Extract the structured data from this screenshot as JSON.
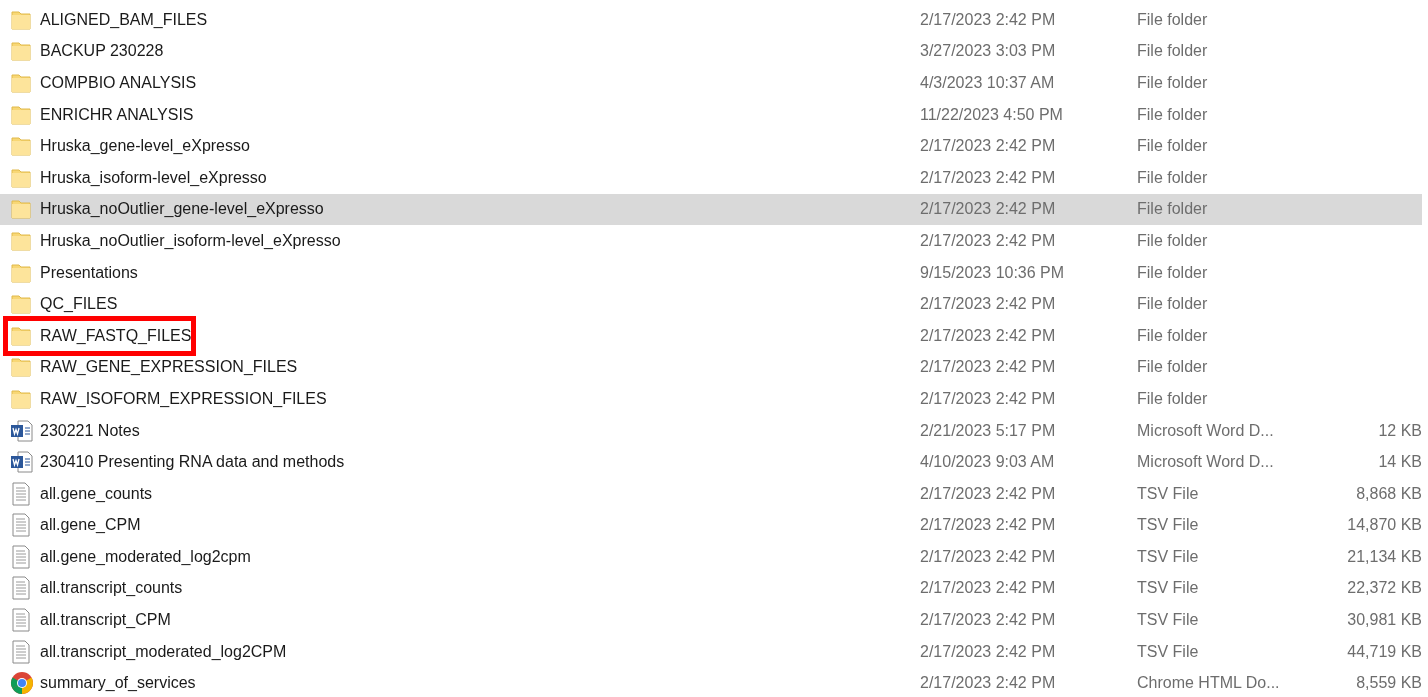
{
  "files": [
    {
      "kind": "folder",
      "name": "ALIGNED_BAM_FILES",
      "modified": "2/17/2023 2:42 PM",
      "type": "File folder",
      "selected": false,
      "highlighted": false
    },
    {
      "kind": "folder",
      "name": "BACKUP 230228",
      "modified": "3/27/2023 3:03 PM",
      "type": "File folder",
      "selected": false,
      "highlighted": false
    },
    {
      "kind": "folder",
      "name": "COMPBIO ANALYSIS",
      "modified": "4/3/2023 10:37 AM",
      "type": "File folder",
      "selected": false,
      "highlighted": false
    },
    {
      "kind": "folder",
      "name": "ENRICHR ANALYSIS",
      "modified": "11/22/2023 4:50 PM",
      "type": "File folder",
      "selected": false,
      "highlighted": false
    },
    {
      "kind": "folder",
      "name": "Hruska_gene-level_eXpresso",
      "modified": "2/17/2023 2:42 PM",
      "type": "File folder",
      "selected": false,
      "highlighted": false
    },
    {
      "kind": "folder",
      "name": "Hruska_isoform-level_eXpresso",
      "modified": "2/17/2023 2:42 PM",
      "type": "File folder",
      "selected": false,
      "highlighted": false
    },
    {
      "kind": "folder",
      "name": "Hruska_noOutlier_gene-level_eXpresso",
      "modified": "2/17/2023 2:42 PM",
      "type": "File folder",
      "selected": true,
      "highlighted": false
    },
    {
      "kind": "folder",
      "name": "Hruska_noOutlier_isoform-level_eXpresso",
      "modified": "2/17/2023 2:42 PM",
      "type": "File folder",
      "selected": false,
      "highlighted": false
    },
    {
      "kind": "folder",
      "name": "Presentations",
      "modified": "9/15/2023 10:36 PM",
      "type": "File folder",
      "selected": false,
      "highlighted": false
    },
    {
      "kind": "folder",
      "name": "QC_FILES",
      "modified": "2/17/2023 2:42 PM",
      "type": "File folder",
      "selected": false,
      "highlighted": false
    },
    {
      "kind": "folder",
      "name": "RAW_FASTQ_FILES",
      "modified": "2/17/2023 2:42 PM",
      "type": "File folder",
      "selected": false,
      "highlighted": true
    },
    {
      "kind": "folder",
      "name": "RAW_GENE_EXPRESSION_FILES",
      "modified": "2/17/2023 2:42 PM",
      "type": "File folder",
      "selected": false,
      "highlighted": false
    },
    {
      "kind": "folder",
      "name": "RAW_ISOFORM_EXPRESSION_FILES",
      "modified": "2/17/2023 2:42 PM",
      "type": "File folder",
      "selected": false,
      "highlighted": false
    },
    {
      "kind": "word",
      "name": "230221 Notes",
      "modified": "2/21/2023 5:17 PM",
      "type": "Microsoft Word D...",
      "size": "12 KB",
      "selected": false,
      "highlighted": false
    },
    {
      "kind": "word",
      "name": "230410 Presenting RNA data and methods",
      "modified": "4/10/2023 9:03 AM",
      "type": "Microsoft Word D...",
      "size": "14 KB",
      "selected": false,
      "highlighted": false
    },
    {
      "kind": "text",
      "name": "all.gene_counts",
      "modified": "2/17/2023 2:42 PM",
      "type": "TSV File",
      "size": "8,868 KB",
      "selected": false,
      "highlighted": false
    },
    {
      "kind": "text",
      "name": "all.gene_CPM",
      "modified": "2/17/2023 2:42 PM",
      "type": "TSV File",
      "size": "14,870 KB",
      "selected": false,
      "highlighted": false
    },
    {
      "kind": "text",
      "name": "all.gene_moderated_log2cpm",
      "modified": "2/17/2023 2:42 PM",
      "type": "TSV File",
      "size": "21,134 KB",
      "selected": false,
      "highlighted": false
    },
    {
      "kind": "text",
      "name": "all.transcript_counts",
      "modified": "2/17/2023 2:42 PM",
      "type": "TSV File",
      "size": "22,372 KB",
      "selected": false,
      "highlighted": false
    },
    {
      "kind": "text",
      "name": "all.transcript_CPM",
      "modified": "2/17/2023 2:42 PM",
      "type": "TSV File",
      "size": "30,981 KB",
      "selected": false,
      "highlighted": false
    },
    {
      "kind": "text",
      "name": "all.transcript_moderated_log2CPM",
      "modified": "2/17/2023 2:42 PM",
      "type": "TSV File",
      "size": "44,719 KB",
      "selected": false,
      "highlighted": false
    },
    {
      "kind": "chrome",
      "name": "summary_of_services",
      "modified": "2/17/2023 2:42 PM",
      "type": "Chrome HTML Do...",
      "size": "8,559 KB",
      "selected": false,
      "highlighted": false
    }
  ]
}
